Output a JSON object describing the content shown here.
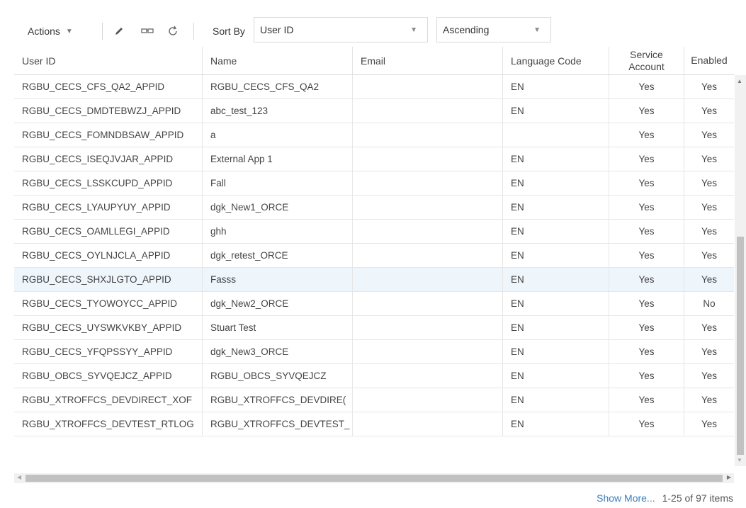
{
  "toolbar": {
    "actions_label": "Actions",
    "icons": [
      "edit-icon",
      "view-icon",
      "refresh-icon"
    ],
    "sort_by_label": "Sort By",
    "sort_field": "User ID",
    "sort_order": "Ascending"
  },
  "table": {
    "columns": {
      "user_id": "User ID",
      "name": "Name",
      "email": "Email",
      "language": "Language Code",
      "service": "Service Account",
      "enabled": "Enabled"
    },
    "rows": [
      {
        "user_id": "RGBU_CECS_CFS_QA2_APPID",
        "name": "RGBU_CECS_CFS_QA2",
        "email": "",
        "language": "EN",
        "service": "Yes",
        "enabled": "Yes"
      },
      {
        "user_id": "RGBU_CECS_DMDTEBWZJ_APPID",
        "name": "abc_test_123",
        "email": "",
        "language": "EN",
        "service": "Yes",
        "enabled": "Yes"
      },
      {
        "user_id": "RGBU_CECS_FOMNDBSAW_APPID",
        "name": "a",
        "email": "",
        "language": "",
        "service": "Yes",
        "enabled": "Yes"
      },
      {
        "user_id": "RGBU_CECS_ISEQJVJAR_APPID",
        "name": "External App 1",
        "email": "",
        "language": "EN",
        "service": "Yes",
        "enabled": "Yes"
      },
      {
        "user_id": "RGBU_CECS_LSSKCUPD_APPID",
        "name": "Fall",
        "email": "",
        "language": "EN",
        "service": "Yes",
        "enabled": "Yes"
      },
      {
        "user_id": "RGBU_CECS_LYAUPYUY_APPID",
        "name": "dgk_New1_ORCE",
        "email": "",
        "language": "EN",
        "service": "Yes",
        "enabled": "Yes"
      },
      {
        "user_id": "RGBU_CECS_OAMLLEGI_APPID",
        "name": "ghh",
        "email": "",
        "language": "EN",
        "service": "Yes",
        "enabled": "Yes"
      },
      {
        "user_id": "RGBU_CECS_OYLNJCLA_APPID",
        "name": "dgk_retest_ORCE",
        "email": "",
        "language": "EN",
        "service": "Yes",
        "enabled": "Yes"
      },
      {
        "user_id": "RGBU_CECS_SHXJLGTO_APPID",
        "name": "Fasss",
        "email": "",
        "language": "EN",
        "service": "Yes",
        "enabled": "Yes",
        "selected": true
      },
      {
        "user_id": "RGBU_CECS_TYOWOYCC_APPID",
        "name": "dgk_New2_ORCE",
        "email": "",
        "language": "EN",
        "service": "Yes",
        "enabled": "No"
      },
      {
        "user_id": "RGBU_CECS_UYSWKVKBY_APPID",
        "name": "Stuart Test",
        "email": "",
        "language": "EN",
        "service": "Yes",
        "enabled": "Yes"
      },
      {
        "user_id": "RGBU_CECS_YFQPSSYY_APPID",
        "name": "dgk_New3_ORCE",
        "email": "",
        "language": "EN",
        "service": "Yes",
        "enabled": "Yes"
      },
      {
        "user_id": "RGBU_OBCS_SYVQEJCZ_APPID",
        "name": "RGBU_OBCS_SYVQEJCZ",
        "email": "",
        "language": "EN",
        "service": "Yes",
        "enabled": "Yes"
      },
      {
        "user_id": "RGBU_XTROFFCS_DEVDIRECT_XOF",
        "name": "RGBU_XTROFFCS_DEVDIRE(",
        "email": "",
        "language": "EN",
        "service": "Yes",
        "enabled": "Yes"
      },
      {
        "user_id": "RGBU_XTROFFCS_DEVTEST_RTLOG",
        "name": "RGBU_XTROFFCS_DEVTEST_",
        "email": "",
        "language": "EN",
        "service": "Yes",
        "enabled": "Yes"
      }
    ]
  },
  "footer": {
    "show_more": "Show More...",
    "range": "1-25 of 97 items"
  },
  "colors": {
    "link": "#3a7fbf",
    "selected_row": "#eef5fb",
    "border": "#e6e6e6"
  }
}
